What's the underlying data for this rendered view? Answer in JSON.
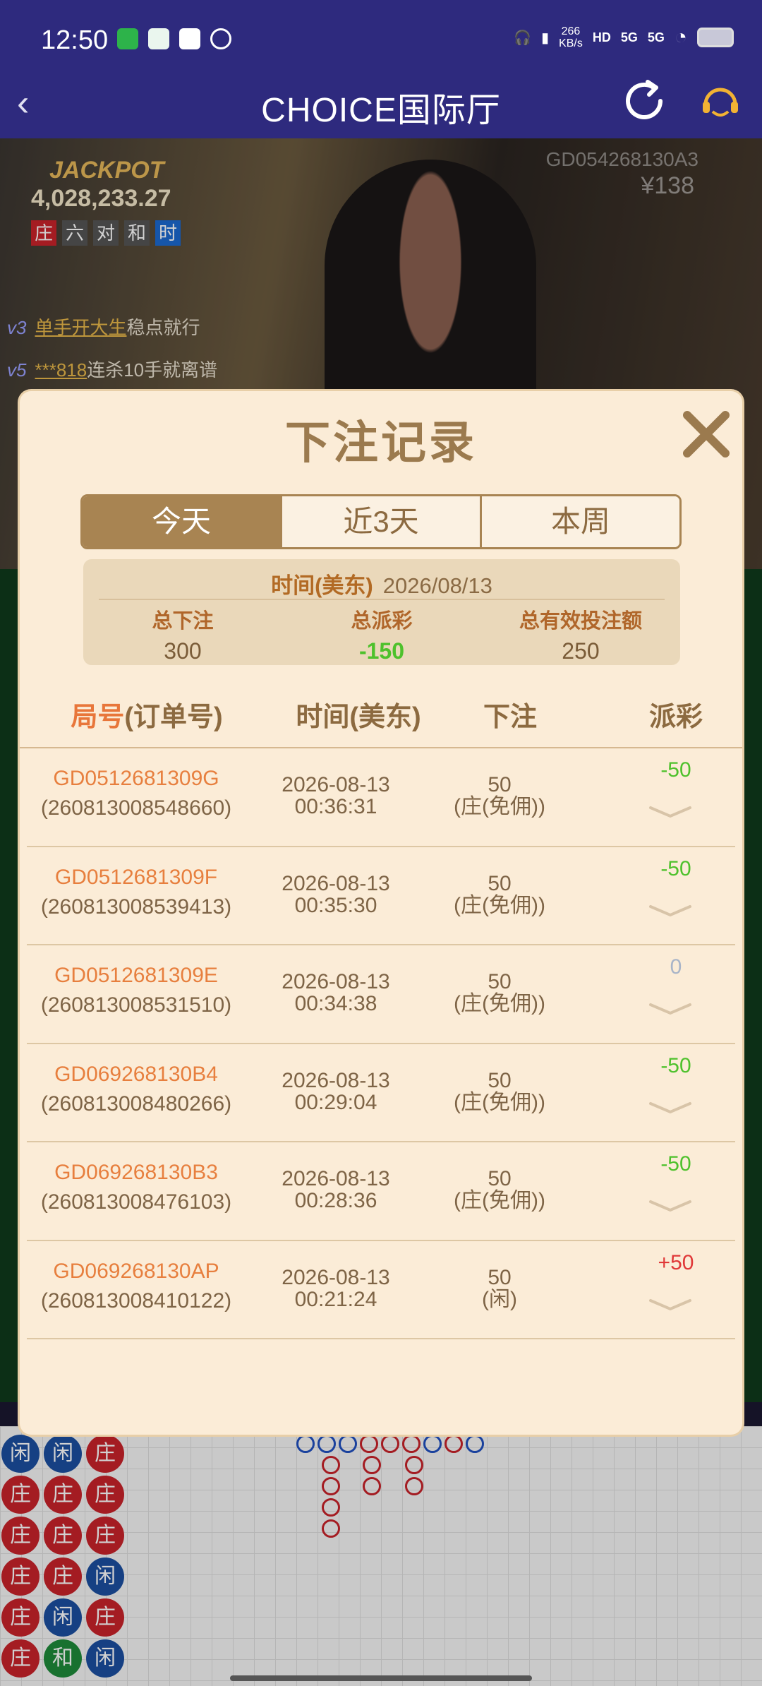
{
  "status_bar": {
    "time": "12:50",
    "net_speed_value": "266",
    "net_speed_unit": "KB/s",
    "hd_label": "HD",
    "signal_1": "5G",
    "signal_2": "5G"
  },
  "header": {
    "title": "CHOICE国际厅",
    "back_icon": "chevron-left-icon",
    "refresh_icon": "refresh-icon",
    "service_icon": "customer-service-icon"
  },
  "video": {
    "jackpot_label": "JACKPOT",
    "jackpot_amount": "4,028,233.27",
    "bet_tags": [
      "庄",
      "六",
      "对",
      "和",
      "时"
    ],
    "round_id": "GD054268130A3",
    "amount": "¥138",
    "chat": [
      {
        "level": "v3",
        "nick": "单手开大生",
        "text": "稳点就行"
      },
      {
        "level": "v5",
        "nick": "***818",
        "text": "连杀10手就离谱"
      }
    ]
  },
  "modal": {
    "title": "下注记录",
    "close_icon": "close-icon",
    "tabs": [
      {
        "label": "今天",
        "active": true
      },
      {
        "label": "近3天",
        "active": false
      },
      {
        "label": "本周",
        "active": false
      }
    ],
    "summary": {
      "date_label": "时间(美东)",
      "date_value": "2026/08/13",
      "total_bet_label": "总下注",
      "total_bet_value": "300",
      "total_payout_label": "总派彩",
      "total_payout_value": "-150",
      "total_valid_label": "总有效投注额",
      "total_valid_value": "250"
    },
    "table": {
      "headers": {
        "round_prefix": "局号",
        "round_suffix": "(订单号)",
        "time": "时间(美东)",
        "bet": "下注",
        "payout": "派彩"
      },
      "rows": [
        {
          "round": "GD0512681309G",
          "order": "(260813008548660)",
          "date": "2026-08-13",
          "time": "00:36:31",
          "amount": "50",
          "bet_type": "(庄(免佣))",
          "payout": "-50"
        },
        {
          "round": "GD0512681309F",
          "order": "(260813008539413)",
          "date": "2026-08-13",
          "time": "00:35:30",
          "amount": "50",
          "bet_type": "(庄(免佣))",
          "payout": "-50"
        },
        {
          "round": "GD0512681309E",
          "order": "(260813008531510)",
          "date": "2026-08-13",
          "time": "00:34:38",
          "amount": "50",
          "bet_type": "(庄(免佣))",
          "payout": "0"
        },
        {
          "round": "GD069268130B4",
          "order": "(260813008480266)",
          "date": "2026-08-13",
          "time": "00:29:04",
          "amount": "50",
          "bet_type": "(庄(免佣))",
          "payout": "-50"
        },
        {
          "round": "GD069268130B3",
          "order": "(260813008476103)",
          "date": "2026-08-13",
          "time": "00:28:36",
          "amount": "50",
          "bet_type": "(庄(免佣))",
          "payout": "-50"
        },
        {
          "round": "GD069268130AP",
          "order": "(260813008410122)",
          "date": "2026-08-13",
          "time": "00:21:24",
          "amount": "50",
          "bet_type": "(闲)",
          "payout": "+50"
        }
      ]
    }
  },
  "roadmap": {
    "beads": [
      [
        "闲",
        "闲",
        "庄"
      ],
      [
        "庄",
        "庄",
        "庄"
      ],
      [
        "庄",
        "庄",
        "庄"
      ],
      [
        "庄",
        "庄",
        "闲"
      ],
      [
        "庄",
        "闲",
        "庄"
      ],
      [
        "庄",
        "和",
        "闲"
      ]
    ]
  },
  "colors": {
    "header_bg": "#2e2a7e",
    "modal_bg": "#fbecd7",
    "accent_brown": "#a88452",
    "accent_orange": "#e77f3e",
    "loss_green": "#4ec12c",
    "win_red": "#e03838"
  }
}
